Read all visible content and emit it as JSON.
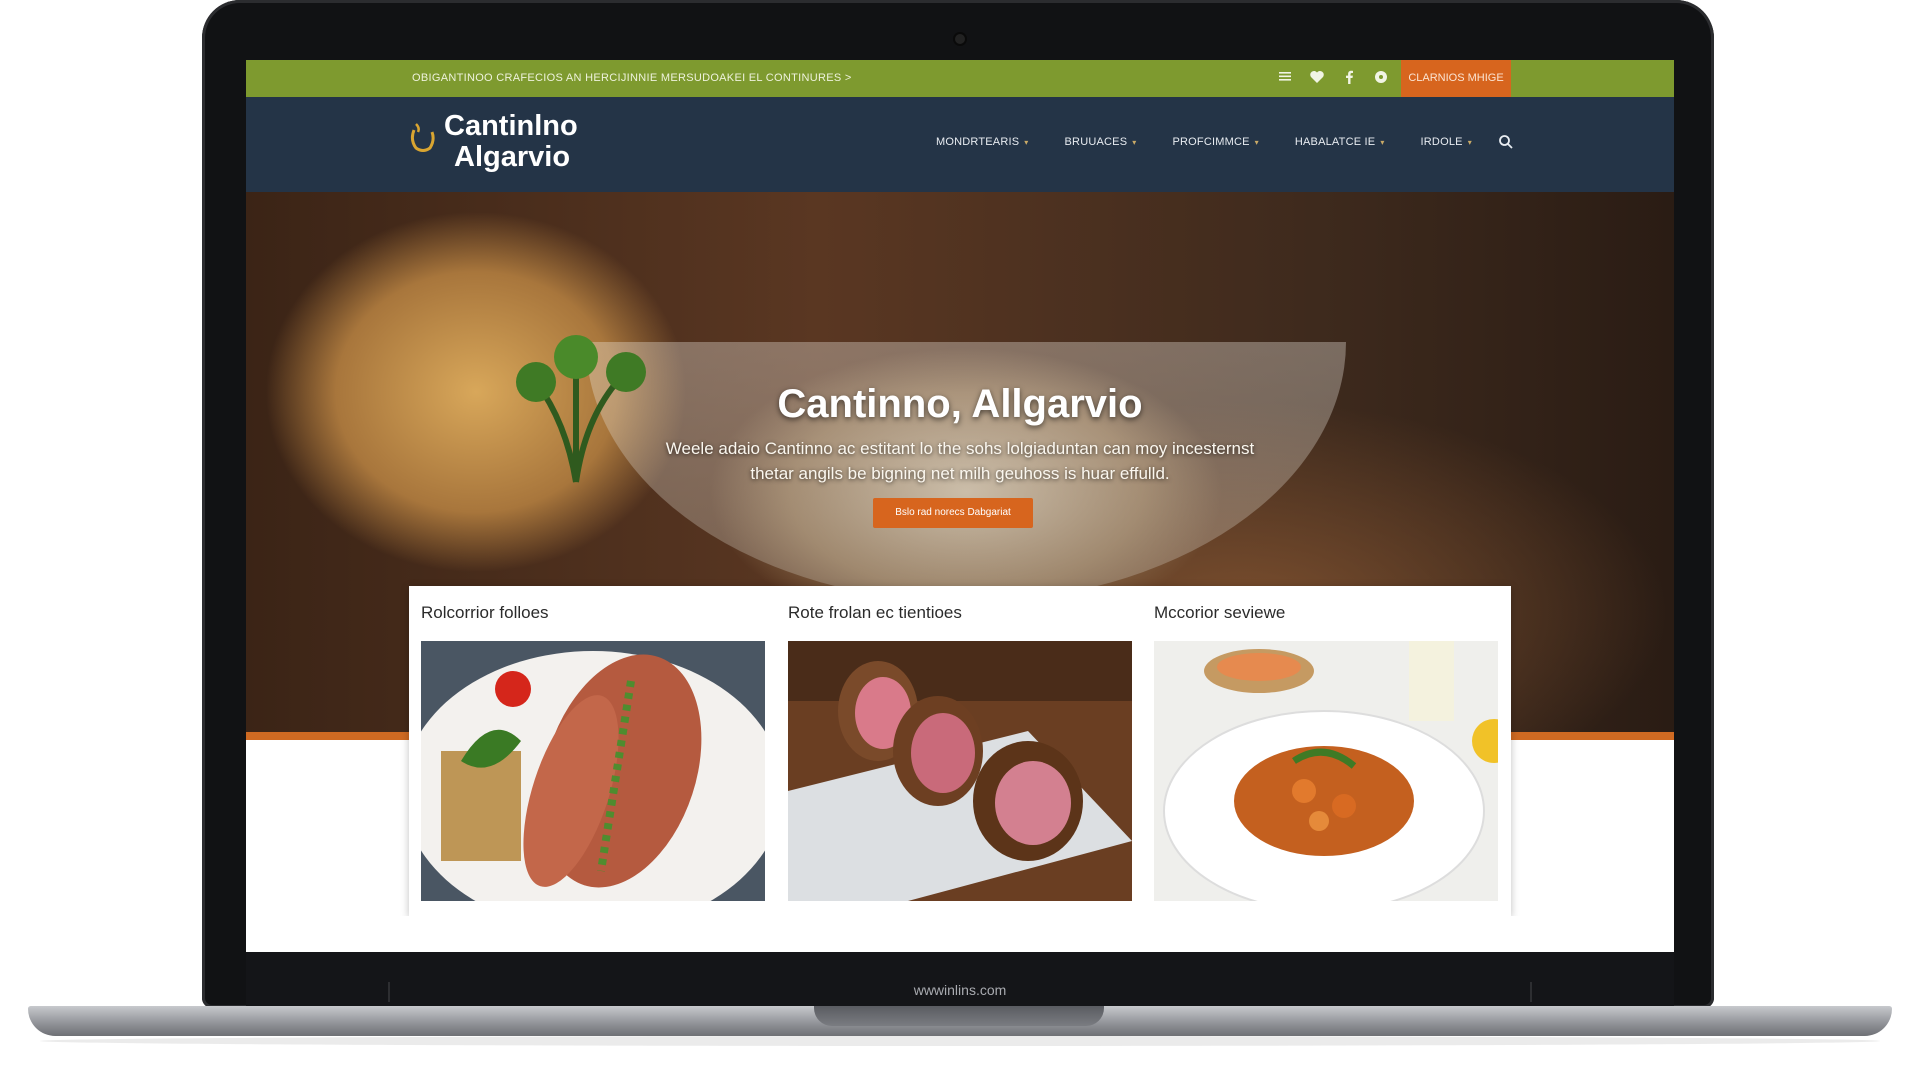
{
  "topbar": {
    "announcement": "OBIGANTINOO CRAFECIOS AN HERCIJINNIE MERSUDOAKEI EL CONTINURES  >",
    "cta": "CLARNIOS MHIGE",
    "icons": [
      "menu-icon",
      "heart-icon",
      "facebook-icon",
      "chat-icon"
    ]
  },
  "brand": {
    "line1": "Cantinlno",
    "line2": "Algarvio"
  },
  "nav": {
    "items": [
      {
        "label": "MONDRTEARIS"
      },
      {
        "label": "BRUUACES"
      },
      {
        "label": "PROFCIMMCE"
      },
      {
        "label": "HABALATCE IE"
      },
      {
        "label": "IRDOLE"
      }
    ]
  },
  "hero": {
    "title": "Cantinno, Allgarvio",
    "subtitle": "Weele adaio Cantinno ac estitant lo the sohs lolgiaduntan can moy incesternst thetar angils be bigning net milh geuhoss is huar effulld.",
    "button": "Bslo rad norecs Dabgariat"
  },
  "cards": [
    {
      "title": "Rolcorrior folloes",
      "image": "grilled-sausage-plate"
    },
    {
      "title": "Rote frolan ec tientioes",
      "image": "sliced-meat-roll"
    },
    {
      "title": "Mccorior seviewe",
      "image": "vegetable-stew-plate"
    }
  ],
  "laptop": {
    "label": "wwwinlins.com"
  },
  "colors": {
    "topbar": "#7e9a2f",
    "navbar": "#243447",
    "accent": "#d7651e"
  }
}
